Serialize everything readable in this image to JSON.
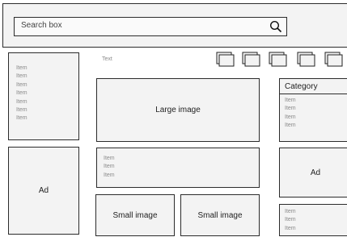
{
  "header": {
    "search_placeholder": "Search box",
    "search_icon": "magnifier-icon"
  },
  "left": {
    "items": [
      "Item",
      "Item",
      "Item",
      "Item",
      "Item",
      "Item",
      "Item"
    ],
    "ad_label": "Ad"
  },
  "middle": {
    "text_label": "Text",
    "large_image_label": "Large image",
    "items": [
      "Item",
      "Item",
      "Item"
    ],
    "small_image_1": "Small image",
    "small_image_2": "Small image"
  },
  "right": {
    "category_title": "Category",
    "category_items": [
      "Item",
      "Item",
      "Item",
      "Item"
    ],
    "ad_label": "Ad",
    "bottom_items": [
      "Item",
      "Item",
      "Item"
    ]
  }
}
